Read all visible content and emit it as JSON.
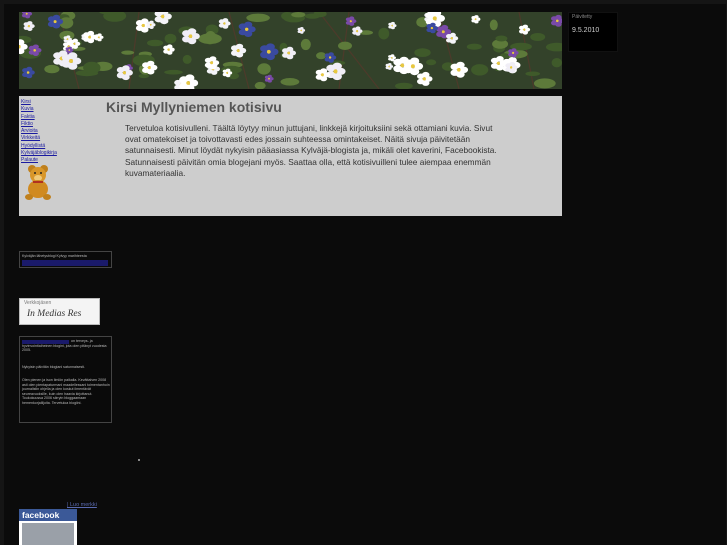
{
  "date_box": {
    "label": "Päivitetty",
    "date": "9.5.2010"
  },
  "nav": {
    "items": [
      "Kirsi",
      "Kuvia",
      "Faktia",
      "Fiktio",
      "Arvioita",
      "Virkkeitä",
      "Hyödyllistä",
      "Kylväjäblogikirja",
      "Palaute"
    ]
  },
  "main": {
    "title": "Kirsi Myllyniemen kotisivu",
    "intro": "Tervetuloa kotisivulleni. Täältä löytyy minun juttujani, linkkejä kirjoituksiini sekä ottamiani kuvia. Sivut ovat omatekoiset ja toivottavasti edes jossain suhteessa omintakeiset. Näitä sivuja päivitetään satunnaisesti. Minut löydät nykyisin pääasiassa Kylväjä-blogista ja, mikäli olet kaverini, Facebookista. Satunnaisesti päivitän omia blogejani myös. Saattaa olla, että kotisivuilleni tulee aiempaa enemmän kuvamateriaalia."
  },
  "sidebar": {
    "box1_text": "Kylväjän lähetysblogi Kylvyy marihteesta",
    "medias_small": "Verkkojäsen",
    "medias_logo": "In Medias Res",
    "box3_p1": "on terveys- ja hyvinvointiaiheinen blogini, jota olen pitänyt vuodesta 2005.",
    "box3_p2": "Nykyisin päivitän blogiani satunnaisesti.",
    "box3_p3": "Olen pienen ja ison ilmiön paikalla. Kevättalven 2008 asti olen pientapaturmani maadellessani toimentanhoin journalistin ohjella ja olen koskut ilmentävät seureavuoksille, kuin olen haavia kirjottanut. Toukokuussa 2006 siirryin bloggaamaan hemenkorjailijoita. Tervetuloa blogiini."
  },
  "footer": {
    "add_link": "| Luo merkki",
    "facebook_label": "facebook"
  },
  "colors": {
    "page_bg": "#0b0b0b",
    "content_bg": "#cdcdcd",
    "link": "#1a1aa0",
    "facebook": "#3b5998"
  }
}
